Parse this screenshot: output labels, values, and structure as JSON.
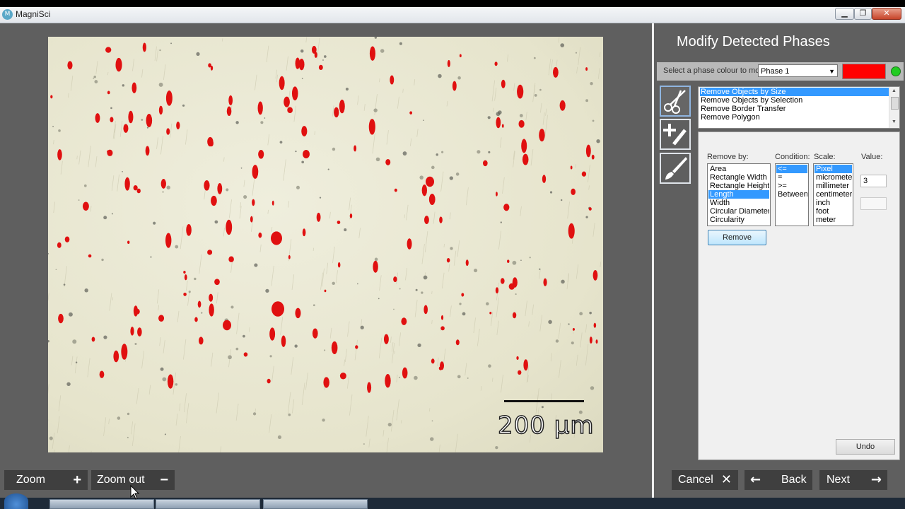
{
  "window": {
    "app_name": "MagniSci",
    "app_icon_glyph": "M",
    "controls": {
      "minimize": "▁",
      "maximize": "❐",
      "close": "✕"
    }
  },
  "image_view": {
    "scale_label": "200 µm",
    "zoom_in": {
      "label": "Zoom",
      "icon": "+"
    },
    "zoom_out": {
      "label": "Zoom out",
      "icon": "−"
    }
  },
  "panel": {
    "title": "Modify Detected Phases",
    "phase_prompt": "Select a phase colour to modify",
    "phase_selected": "Phase 1",
    "dropdown_arrow": "▼",
    "phase_color": "#ff0000",
    "status_color": "#22cc22",
    "tools": [
      "scissors-icon",
      "add-edit-icon",
      "brush-icon"
    ],
    "methods": [
      {
        "label": "Remove Objects by Size",
        "selected": true
      },
      {
        "label": "Remove Objects by Selection",
        "selected": false
      },
      {
        "label": "Remove Border Transfer",
        "selected": false
      },
      {
        "label": "Remove Polygon",
        "selected": false
      }
    ],
    "remove_by": {
      "label": "Remove by:",
      "options": [
        "Area",
        "Rectangle Width",
        "Rectangle Height",
        "Length",
        "Width",
        "Circular Diameter",
        "Circularity"
      ],
      "selected": "Length"
    },
    "condition": {
      "label": "Condition:",
      "options": [
        "<=",
        "=",
        ">=",
        "Between"
      ],
      "selected": "<="
    },
    "scale": {
      "label": "Scale:",
      "options": [
        "Pixel",
        "micrometer",
        "millimeter",
        "centimeter",
        "inch",
        "foot",
        "meter"
      ],
      "selected": "Pixel"
    },
    "value": {
      "label": "Value:",
      "current": "3"
    },
    "remove_button": "Remove",
    "undo_button": "Undo"
  },
  "footer": {
    "cancel": {
      "label": "Cancel",
      "icon": "✕"
    },
    "back": {
      "label": "Back",
      "icon": "←"
    },
    "next": {
      "label": "Next",
      "icon": "→"
    }
  }
}
